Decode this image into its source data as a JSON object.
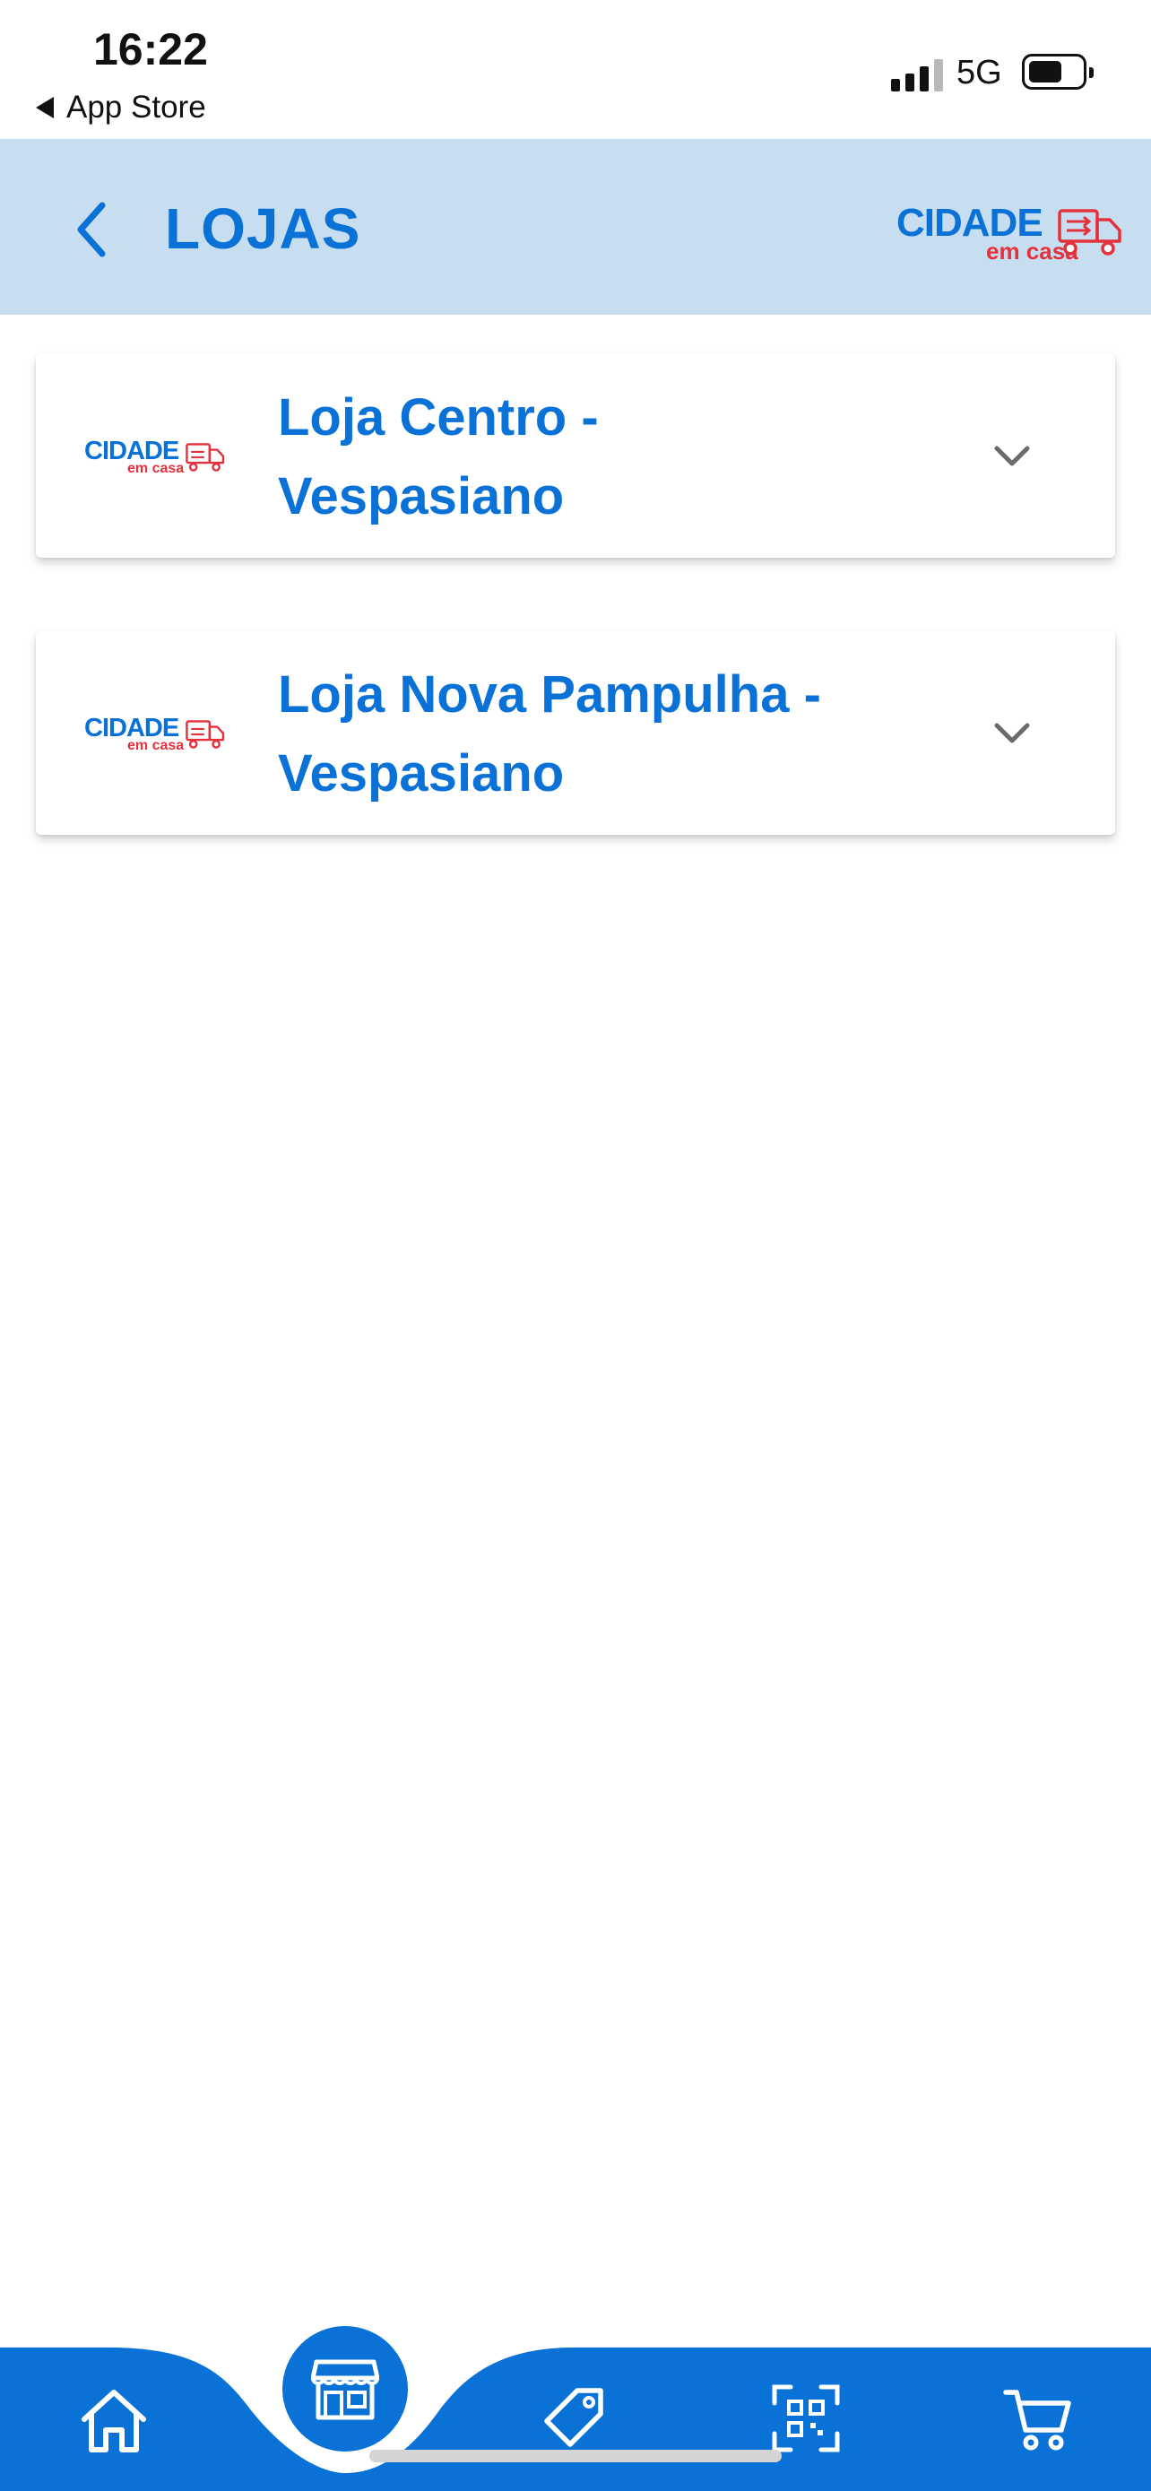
{
  "status_bar": {
    "time": "16:22",
    "back_app_label": "App Store",
    "network": "5G",
    "signal_bars_active": 3,
    "signal_bars_total": 4,
    "battery_level": 0.5
  },
  "header": {
    "title": "LOJAS",
    "back_icon": "chevron-left-icon",
    "logo": {
      "brand": "CIDADE",
      "sub": "em casa",
      "icon": "delivery-truck-icon"
    },
    "background_color": "#c6def0"
  },
  "stores": [
    {
      "name": "Loja Centro - Vespasiano",
      "logo": {
        "brand": "CIDADE",
        "sub": "em casa"
      },
      "expand_icon": "chevron-down-icon"
    },
    {
      "name": "Loja Nova Pampulha - Vespasiano",
      "logo": {
        "brand": "CIDADE",
        "sub": "em casa"
      },
      "expand_icon": "chevron-down-icon"
    }
  ],
  "bottom_nav": {
    "items": [
      {
        "icon": "home-icon",
        "active": false
      },
      {
        "icon": "store-icon",
        "active": true
      },
      {
        "icon": "tag-icon",
        "active": false
      },
      {
        "icon": "qr-code-scanner-icon",
        "active": false
      },
      {
        "icon": "shopping-cart-icon",
        "active": false
      }
    ],
    "color": "#0a72d6"
  },
  "colors": {
    "accent_blue": "#0a72d6",
    "brand_red": "#e4313b",
    "chevron_gray": "#6b6b6b"
  }
}
